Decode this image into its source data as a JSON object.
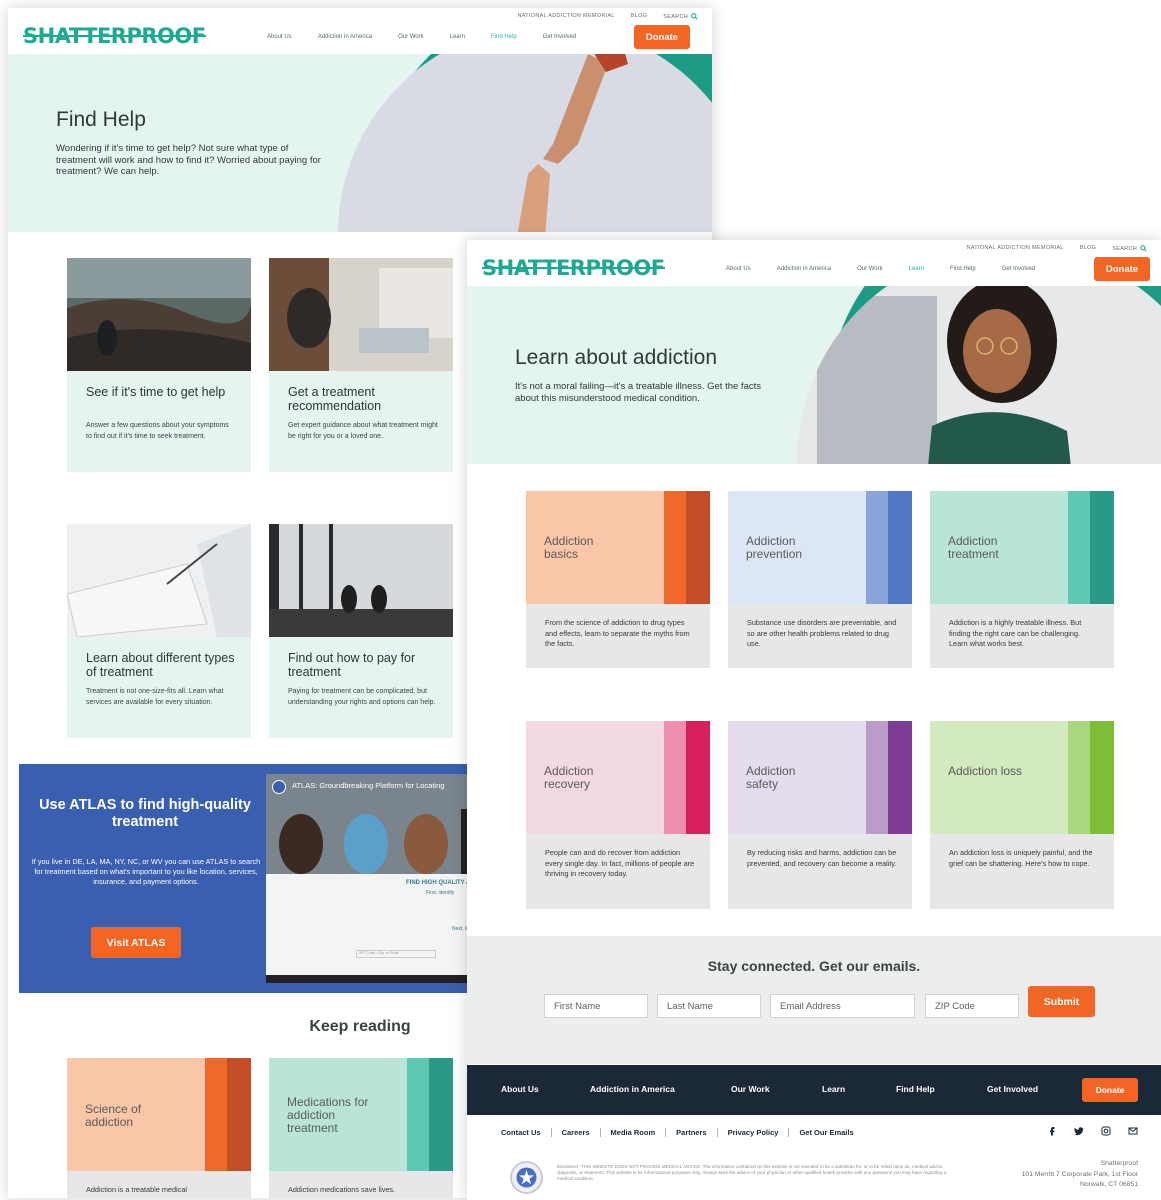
{
  "pageA": {
    "utility": [
      "NATIONAL ADDICTION MEMORIAL",
      "BLOG",
      "SEARCH"
    ],
    "logo": "SHATTERPROOF",
    "nav": [
      "About Us",
      "Addiction in America",
      "Our Work",
      "Learn",
      "Find Help",
      "Get Involved"
    ],
    "donate": "Donate",
    "hero": {
      "title": "Find Help",
      "text": "Wondering if it's time to get help? Not sure what type of treatment will work and how to find it? Worried about paying for treatment? We can help."
    },
    "cards": [
      {
        "title": "See if it's time to get help",
        "desc": "Answer a few questions about your symptoms to find out if it's time to seek treatment."
      },
      {
        "title": "Get a treatment recommendation",
        "desc": "Get expert guidance about what treatment might be right for you or a loved one."
      },
      {
        "title": "Learn about different types of treatment",
        "desc": "Treatment is not one-size-fits all. Learn what services are available for every situation."
      },
      {
        "title": "Find out how to pay for treatment",
        "desc": "Paying for treatment can be complicated, but understanding your rights and options can help."
      }
    ],
    "atlas": {
      "title": "Use ATLAS to find high-quality treatment",
      "desc": "If you live in DE, LA, MA, NY, NC, or WV you can use ATLAS to search for treatment based on what's important to you like location, services, insurance, and payment options.",
      "button": "Visit ATLAS",
      "video_title": "ATLAS: Groundbreaking Platform for Locating",
      "video_heading": "FIND HIGH QUALITY AD",
      "video_first": "First, identify",
      "video_next": "Next, locate",
      "video_zip": "ZIP Code, City, or State"
    },
    "keep_reading": "Keep reading",
    "reading": [
      {
        "label": "Science of addiction",
        "desc": "Addiction is a treatable medical",
        "bg": "#f9c6a8",
        "s1": "#ef6a2a",
        "s2": "#c24d27"
      },
      {
        "label": "Medications for addiction treatment",
        "desc": "Addiction medications save lives.",
        "bg": "#b9e5d9",
        "s1": "#5ec8b3",
        "s2": "#2a9a86"
      }
    ]
  },
  "pageB": {
    "utility": [
      "NATIONAL ADDICTION MEMORIAL",
      "BLOG",
      "SEARCH"
    ],
    "logo": "SHATTERPROOF",
    "nav": [
      "About Us",
      "Addiction in America",
      "Our Work",
      "Learn",
      "Find Help",
      "Get Involved"
    ],
    "donate": "Donate",
    "hero": {
      "title": "Learn about addiction",
      "text": "It's not a moral failing—it's a treatable illness. Get the facts about this misunderstood medical condition."
    },
    "tiles": [
      {
        "label": "Addiction basics",
        "desc": "From the science of addiction to drug types and effects, learn to separate the myths from the facts.",
        "bg": "#f9c6a8",
        "s1": "#ef6a2a",
        "s2": "#c24d27"
      },
      {
        "label": "Addiction prevention",
        "desc": "Substance use disorders are preventable, and so are other health problems related to drug use.",
        "bg": "#dde6f6",
        "s1": "#8aa5dc",
        "s2": "#5478c8"
      },
      {
        "label": "Addiction treatment",
        "desc": "Addiction is a highly treatable illness. But finding the right care can be challenging. Learn what works best.",
        "bg": "#b9e5d9",
        "s1": "#5ec8b3",
        "s2": "#2a9a86"
      },
      {
        "label": "Addiction recovery",
        "desc": "People can and do recover from addiction every single day. In fact, millions of people are thriving in recovery today.",
        "bg": "#f2d9e2",
        "s1": "#ee8fb2",
        "s2": "#d81f5d"
      },
      {
        "label": "Addiction safety",
        "desc": "By reducing risks and harms, addiction can be prevented, and recovery can become a reality.",
        "bg": "#e4dced",
        "s1": "#bb9cc9",
        "s2": "#7e3c94"
      },
      {
        "label": "Addiction loss",
        "desc": "An addiction loss is uniquely painful, and the grief can be shattering. Here's how to cope.",
        "bg": "#d2eabd",
        "s1": "#a8d77e",
        "s2": "#7cbf37"
      }
    ],
    "newsletter": {
      "title": "Stay connected. Get our emails.",
      "fields": [
        "First Name",
        "Last Name",
        "Email Address",
        "ZIP Code"
      ],
      "submit": "Submit"
    },
    "footer_nav": [
      "About Us",
      "Addiction in America",
      "Our Work",
      "Learn",
      "Find Help",
      "Get Involved"
    ],
    "footer_donate": "Donate",
    "footer_links": [
      "Contact Us",
      "Careers",
      "Media Room",
      "Partners",
      "Privacy Policy",
      "Get Our Emails"
    ],
    "disclaimer": "Disclaimer: THIS WEBSITE DOES NOT PROVIDE MEDICAL ADVICE. The information contained on this website is not intended to be a substitute for, or to be relied upon as, medical advice, diagnosis, or treatment. This website is for informational purposes only. Always seek the advice of your physician or other qualified health provider with any questions you may have regarding a medical condition.",
    "address": [
      "Shatterproof",
      "101 Merritt 7 Corporate Park, 1st Floor",
      "Norwalk, CT 06851"
    ],
    "social": [
      "facebook-icon",
      "twitter-icon",
      "instagram-icon",
      "email-icon"
    ]
  }
}
